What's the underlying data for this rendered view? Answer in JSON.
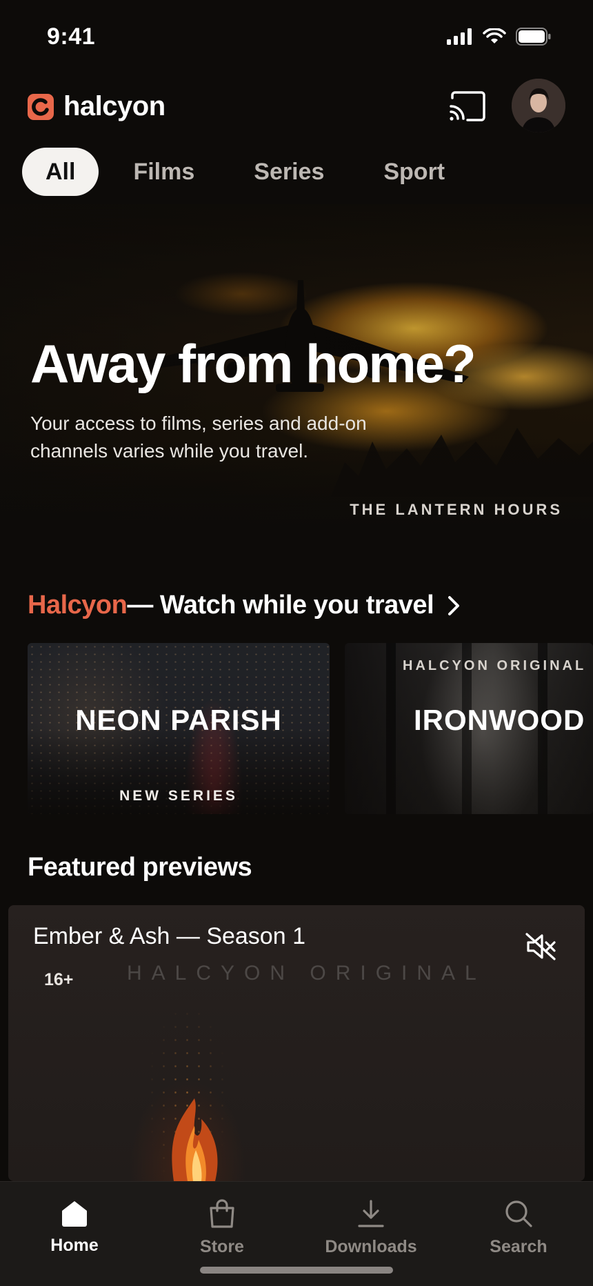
{
  "status_bar": {
    "time": "9:41"
  },
  "header": {
    "app_name": "halcyon",
    "brand_color": "#e8674a"
  },
  "tabs": [
    {
      "label": "All",
      "active": true
    },
    {
      "label": "Films",
      "active": false
    },
    {
      "label": "Series",
      "active": false
    },
    {
      "label": "Sport",
      "active": false
    }
  ],
  "hero": {
    "title": "Away from home?",
    "subtitle": "Your access to films, series and add-on channels varies while you travel.",
    "caption": "THE LANTERN HOURS"
  },
  "travel_section": {
    "brand": "Halcyon",
    "title": " — Watch while you travel",
    "cards": [
      {
        "title": "NEON PARISH",
        "badge": "NEW SERIES"
      },
      {
        "title": "IRONWOOD",
        "top_badge": "HALCYON ORIGINAL"
      }
    ]
  },
  "featured": {
    "heading": "Featured previews",
    "preview": {
      "title": "Ember & Ash — Season 1",
      "rating": "16+",
      "watermark": "HALCYON ORIGINAL",
      "mute_icon": "speaker-muted-icon"
    }
  },
  "bottom_nav": [
    {
      "label": "Home",
      "icon": "home-icon",
      "active": true
    },
    {
      "label": "Store",
      "icon": "bag-icon",
      "active": false
    },
    {
      "label": "Downloads",
      "icon": "download-icon",
      "active": false
    },
    {
      "label": "Search",
      "icon": "search-icon",
      "active": false
    }
  ]
}
